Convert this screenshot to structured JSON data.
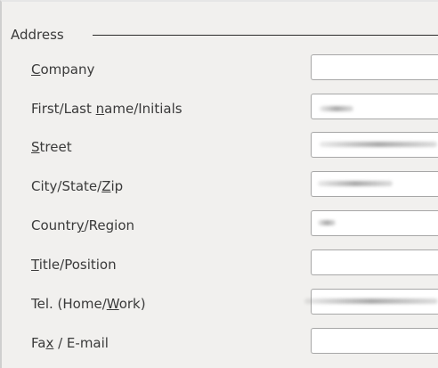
{
  "address_group": {
    "title": "Address"
  },
  "fields": [
    {
      "label_pre": "",
      "mnemonic": "C",
      "label_post": "ompany",
      "value": ""
    },
    {
      "label_pre": "First/Last ",
      "mnemonic": "n",
      "label_post": "ame/Initials",
      "value": ""
    },
    {
      "label_pre": "",
      "mnemonic": "S",
      "label_post": "treet",
      "value": ""
    },
    {
      "label_pre": "City/State/",
      "mnemonic": "Z",
      "label_post": "ip",
      "value": ""
    },
    {
      "label_pre": "Countr",
      "mnemonic": "y",
      "label_post": "/Region",
      "value": ""
    },
    {
      "label_pre": "",
      "mnemonic": "T",
      "label_post": "itle/Position",
      "value": ""
    },
    {
      "label_pre": "Tel. (Home/",
      "mnemonic": "W",
      "label_post": "ork)",
      "value": ""
    },
    {
      "label_pre": "Fa",
      "mnemonic": "x",
      "label_post": " / E-mail",
      "value": ""
    }
  ]
}
